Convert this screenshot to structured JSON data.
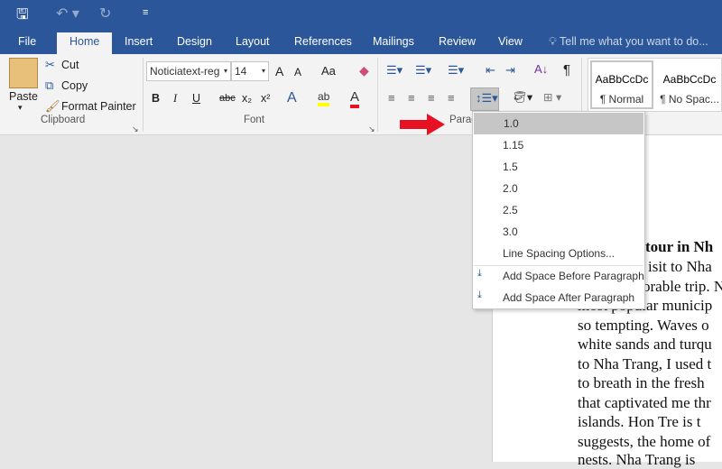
{
  "quick_access": {
    "save_icon": "save-icon",
    "undo_icon": "undo-icon",
    "redo_icon": "redo-icon",
    "customize_icon": "customize-icon"
  },
  "tabs": [
    "File",
    "Home",
    "Insert",
    "Design",
    "Layout",
    "References",
    "Mailings",
    "Review",
    "View"
  ],
  "tell_me": "Tell me what you want to do...",
  "clipboard": {
    "paste": "Paste",
    "cut": "Cut",
    "copy": "Copy",
    "format_painter": "Format Painter",
    "group": "Clipboard"
  },
  "font": {
    "name": "Noticiatext-reg",
    "size": "14",
    "group": "Font",
    "grow": "A",
    "shrink": "A",
    "case": "Aa",
    "bold": "B",
    "italic": "I",
    "underline": "U",
    "strike": "abc",
    "sub": "x₂",
    "sup": "x²"
  },
  "paragraph": {
    "group": "Paragraph",
    "group_visible": "Parag"
  },
  "styles": [
    {
      "preview": "AaBbCcDc",
      "name": "¶ Normal"
    },
    {
      "preview": "AaBbCcDc",
      "name": "¶ No Spac..."
    }
  ],
  "line_spacing_menu": {
    "items": [
      "1.0",
      "1.15",
      "1.5",
      "2.0",
      "2.5",
      "3.0",
      "Line Spacing Options..."
    ],
    "selected": "1.0",
    "add_before": "Add Space Before Paragraph",
    "add_after": "Add Space After Paragraph"
  },
  "annotation": {
    "arrow_color": "#e81123"
  },
  "document": {
    "lines": [
      "tour in Nh",
      "isit to Nha",
      "orable trip. N",
      "most popular municip",
      "so tempting. Waves o",
      "white sands and turqu",
      "to Nha Trang, I used t",
      "to breath in the fresh",
      "that captivated me thr",
      "islands. Hon Tre is t",
      "suggests, the home of",
      "nests. Nha Trang is"
    ]
  },
  "colors": {
    "accent": "#2b579a",
    "highlight": "#ffff00",
    "font_color": "#e81123"
  }
}
